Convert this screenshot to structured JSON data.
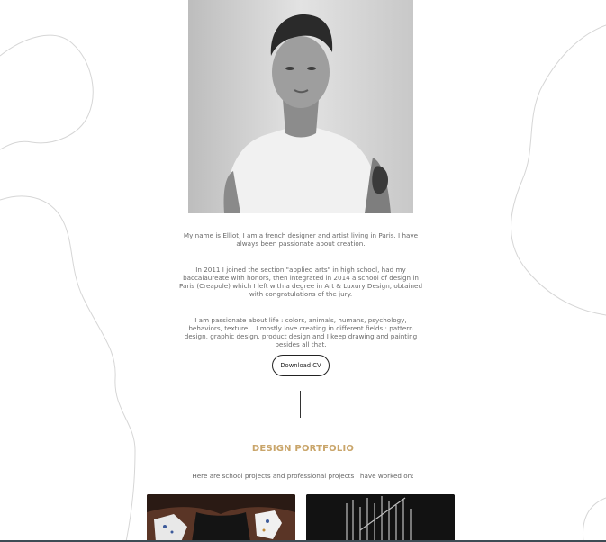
{
  "profile": {
    "photo_icon": "portrait-photo"
  },
  "bio": {
    "paragraph1": "My name is Elliot, I am a french designer and artist living in Paris. I have always been passionate about creation.",
    "paragraph2": "In 2011 I joined the section \"applied arts\" in high school, had my baccalaureate with honors, then integrated in 2014 a school of design in Paris (Creapole) which I left with a degree in Art & Luxury Design, obtained with congratulations of the jury.",
    "paragraph3": "I am passionate about life : colors, animals, humans, psychology, behaviors, texture... I mostly love creating in different fields : pattern design, graphic design, product design and I keep drawing and painting besides all that."
  },
  "cv": {
    "button_label": "Download CV"
  },
  "portfolio": {
    "title": "DESIGN PORTFOLIO",
    "subtitle": "Here are school projects and professional projects I have worked on:"
  },
  "colors": {
    "accent": "#c9a56a",
    "text": "#6a6a6a",
    "divider": "#333333"
  }
}
